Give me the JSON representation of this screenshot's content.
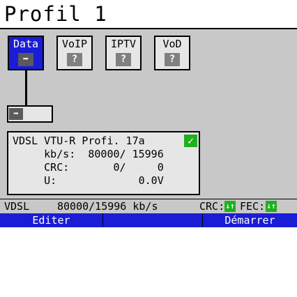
{
  "header": {
    "title": "Profil 1"
  },
  "services": [
    {
      "label": "Data",
      "icon": "arrow-right-icon",
      "active": true
    },
    {
      "label": "VoIP",
      "icon": "question-icon",
      "active": false
    },
    {
      "label": "IPTV",
      "icon": "question-icon",
      "active": false
    },
    {
      "label": "VoD",
      "icon": "question-icon",
      "active": false
    }
  ],
  "port": {
    "icon": "arrow-right-icon"
  },
  "info": {
    "line1": "VDSL VTU-R Profi. 17a",
    "line2": "     kb/s:  80000/ 15996",
    "line3": "     CRC:       0/     0",
    "line4": "     U:             0.0V",
    "status_icon": "check-icon"
  },
  "status_bar": {
    "mode": "VDSL",
    "rate": "80000/15996 kb/s",
    "crc_label": "CRC:",
    "fec_label": "FEC:",
    "badge_glyph": "↓↑"
  },
  "softkeys": [
    {
      "label": "Editer"
    },
    {
      "label": ""
    },
    {
      "label": "Démarrer"
    }
  ],
  "colors": {
    "accent": "#1a1cd6",
    "ok": "#1fb01f",
    "panel": "#c8c8c8"
  }
}
